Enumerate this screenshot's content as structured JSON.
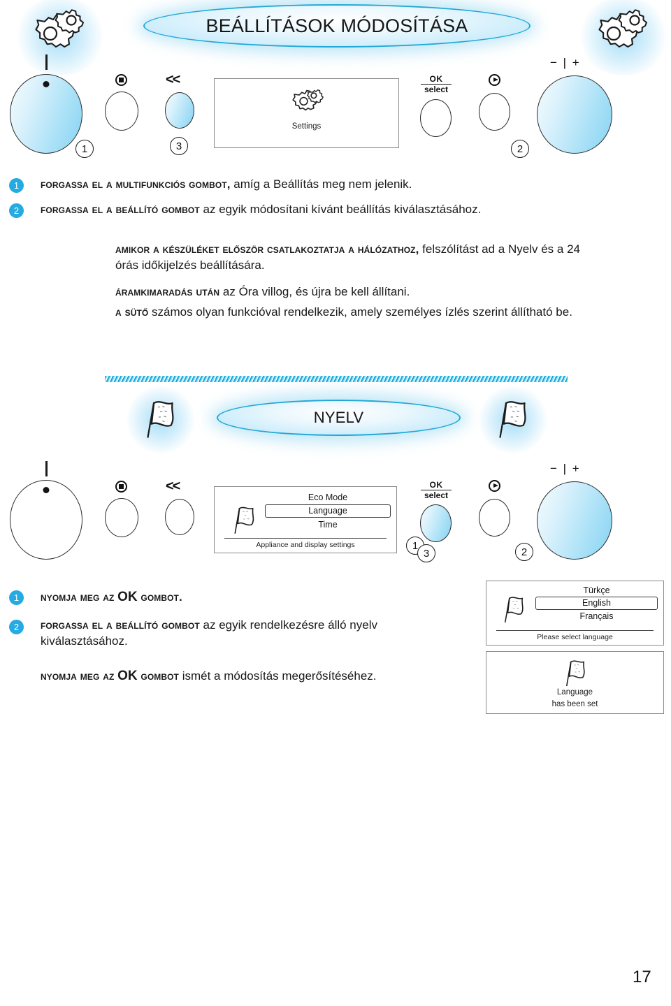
{
  "page": {
    "number": "17",
    "accent_color": "#25aae1",
    "banner_border_color": "#22a8d6"
  },
  "section_settings": {
    "banner_title": "BEÁLLÍTÁSOK MÓDOSÍTÁSA",
    "icon_left": "gears-icon",
    "icon_right": "gears-icon",
    "panel": {
      "power_knob_tick": "|",
      "stop_button_icon": "stop-icon",
      "back_button_icon": "rewind-icon",
      "back_button_glyph": "<<",
      "ok_label_top": "OK",
      "ok_label_bottom": "select",
      "forward_button_icon": "play-icon",
      "temp_knob_label": "− | +",
      "callouts": {
        "knob_left": "1",
        "back_button": "3",
        "knob_right": "2"
      }
    },
    "display": {
      "icon": "gears-icon",
      "caption": "Settings"
    },
    "steps": [
      {
        "badge": "1",
        "lead": "Forgassa el a multifunkciós gombot,",
        "rest": " amíg a Beállítás meg nem jelenik."
      },
      {
        "badge": "2",
        "lead": "Forgassa el a beállító gombot",
        "rest": " az egyik módosítani kívánt beállítás kiválasztásához."
      }
    ],
    "notes": [
      {
        "lead": "Amikor a készüléket először csatlakoztatja a hálózathoz,",
        "rest": " felszólítást ad a Nyelv és a 24 órás időkijelzés beállítására."
      },
      {
        "lead": "Áramkimaradás után",
        "rest": " az Óra villog, és újra be kell állítani."
      },
      {
        "lead": "A sütő",
        "rest": " számos olyan funkcióval rendelkezik, amely személyes ízlés szerint állítható be."
      }
    ]
  },
  "section_language": {
    "banner_title": "NYELV",
    "icon_left": "flag-icon",
    "icon_right": "flag-icon",
    "panel": {
      "power_knob_tick": "|",
      "stop_button_icon": "stop-icon",
      "back_button_icon": "rewind-icon",
      "back_button_glyph": "<<",
      "ok_label_top": "OK",
      "ok_label_bottom": "select",
      "forward_button_icon": "play-icon",
      "temp_knob_label": "− | +",
      "callouts": {
        "ok_button_a": "1",
        "ok_button_b": "3",
        "knob_right": "2"
      }
    },
    "menu_display": {
      "icon": "flag-icon",
      "items": [
        "Eco Mode",
        "Language",
        "Time"
      ],
      "selected": "Language",
      "footer": "Appliance and display settings"
    },
    "steps": [
      {
        "badge": "1",
        "lead": "Nyomja meg az",
        "emphasis": "OK",
        "tail": "gombot."
      },
      {
        "badge": "2",
        "lead": "Forgassa el a beállító gombot",
        "rest": "  az egyik rendelkezésre álló nyelv kiválasztásához."
      }
    ],
    "closing": {
      "lead": "Nyomja meg az",
      "emphasis": "OK",
      "tail": "gombot",
      "rest": " ismét a módosítás megerősítéséhez."
    },
    "language_display": {
      "icon": "flag-icon",
      "options": [
        "Türkçe",
        "English",
        "Français"
      ],
      "selected": "English",
      "footer": "Please select language"
    },
    "confirm_display": {
      "icon": "flag-icon",
      "line1": "Language",
      "line2": "has been set"
    }
  }
}
